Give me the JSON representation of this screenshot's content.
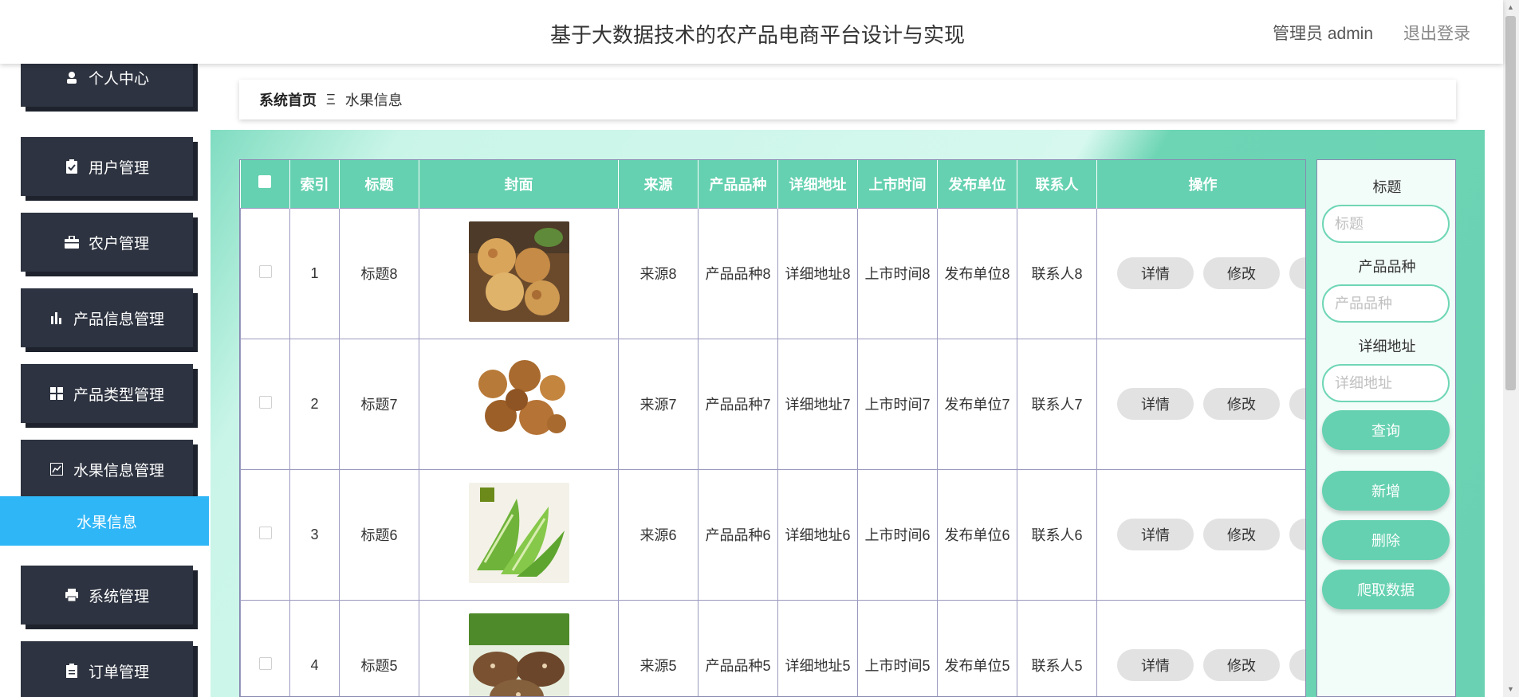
{
  "header": {
    "title": "基于大数据技术的农产品电商平台设计与实现",
    "user": "管理员 admin",
    "logout": "退出登录"
  },
  "sidebar": {
    "items": [
      {
        "label": "个人中心",
        "icon": "user-icon"
      },
      {
        "label": "用户管理",
        "icon": "clipboard-icon"
      },
      {
        "label": "农户管理",
        "icon": "briefcase-icon"
      },
      {
        "label": "产品信息管理",
        "icon": "bar-chart-icon"
      },
      {
        "label": "产品类型管理",
        "icon": "grid-icon"
      },
      {
        "label": "水果信息管理",
        "icon": "line-chart-icon"
      },
      {
        "label": "系统管理",
        "icon": "print-icon"
      },
      {
        "label": "订单管理",
        "icon": "document-icon"
      }
    ],
    "active_submenu": "水果信息"
  },
  "breadcrumb": {
    "home": "系统首页",
    "separator": "Ξ",
    "current": "水果信息"
  },
  "table": {
    "headers": [
      "索引",
      "标题",
      "封面",
      "来源",
      "产品品种",
      "详细地址",
      "上市时间",
      "发布单位",
      "联系人",
      "操作"
    ],
    "rows": [
      {
        "index": "1",
        "title": "标题8",
        "source": "来源8",
        "variety": "产品品种8",
        "address": "详细地址8",
        "time": "上市时间8",
        "unit": "发布单位8",
        "contact": "联系人8",
        "image": "dried-figs"
      },
      {
        "index": "2",
        "title": "标题7",
        "source": "来源7",
        "variety": "产品品种7",
        "address": "详细地址7",
        "time": "上市时间7",
        "unit": "发布单位7",
        "contact": "联系人7",
        "image": "dried-mushrooms"
      },
      {
        "index": "3",
        "title": "标题6",
        "source": "来源6",
        "variety": "产品品种6",
        "address": "详细地址6",
        "time": "上市时间6",
        "unit": "发布单位6",
        "contact": "联系人6",
        "image": "lettuce"
      },
      {
        "index": "4",
        "title": "标题5",
        "source": "来源5",
        "variety": "产品品种5",
        "address": "详细地址5",
        "time": "上市时间5",
        "unit": "发布单位5",
        "contact": "联系人5",
        "image": "shiitake"
      }
    ],
    "op_detail": "详情",
    "op_edit": "修改"
  },
  "search": {
    "title_label": "标题",
    "title_placeholder": "标题",
    "variety_label": "产品品种",
    "variety_placeholder": "产品品种",
    "address_label": "详细地址",
    "address_placeholder": "详细地址",
    "query_button": "查询",
    "add_button": "新增",
    "delete_button": "删除",
    "crawl_button": "爬取数据"
  },
  "colors": {
    "accent": "#65d1b0",
    "sidebar_dark": "#2d3340",
    "active_blue": "#2fb6f7"
  }
}
